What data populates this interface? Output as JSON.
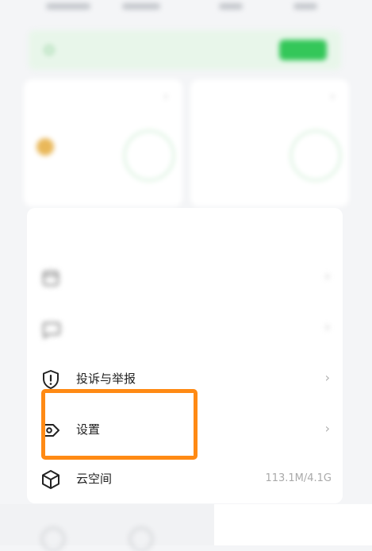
{
  "top_strip": {
    "stats": [
      "",
      "",
      "",
      ""
    ]
  },
  "banner": {
    "text": "",
    "button_label": ""
  },
  "cards": [
    {
      "title": "",
      "big_value": "",
      "sub": ""
    },
    {
      "title": "",
      "big_value": "",
      "sub": ""
    }
  ],
  "panel": {
    "title": "",
    "items": [
      {
        "label": "",
        "icon": "calendar-icon",
        "chevron": "›"
      },
      {
        "label": "",
        "icon": "chat-bubble-icon",
        "chevron": "›"
      },
      {
        "label": "投诉与举报",
        "icon": "shield-alert-icon",
        "chevron": "›"
      },
      {
        "label": "设置",
        "icon": "settings-tag-icon",
        "chevron": "›"
      },
      {
        "label": "云空间",
        "icon": "cube-icon",
        "value": "113.1M/4.1G"
      }
    ]
  },
  "colors": {
    "highlight": "#ff8a14",
    "brand_green": "#34c759",
    "background": "#f4f5f7"
  }
}
